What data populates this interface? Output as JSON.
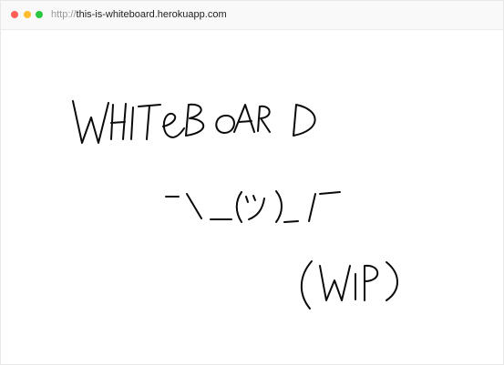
{
  "browser": {
    "url_protocol": "http://",
    "url_host": "this-is-whiteboard.herokuapp.com",
    "colors": {
      "close": "#ff5f57",
      "minimize": "#febc2e",
      "maximize": "#28c840"
    }
  },
  "whiteboard": {
    "ink_color": "#0a0a0a",
    "drawings": [
      {
        "name": "whiteboard-word",
        "text": "WHITEBOARD"
      },
      {
        "name": "shrug-emoticon",
        "text": "¯\\_(ツ)_/¯"
      },
      {
        "name": "wip-label",
        "text": "(WIP)"
      }
    ]
  }
}
